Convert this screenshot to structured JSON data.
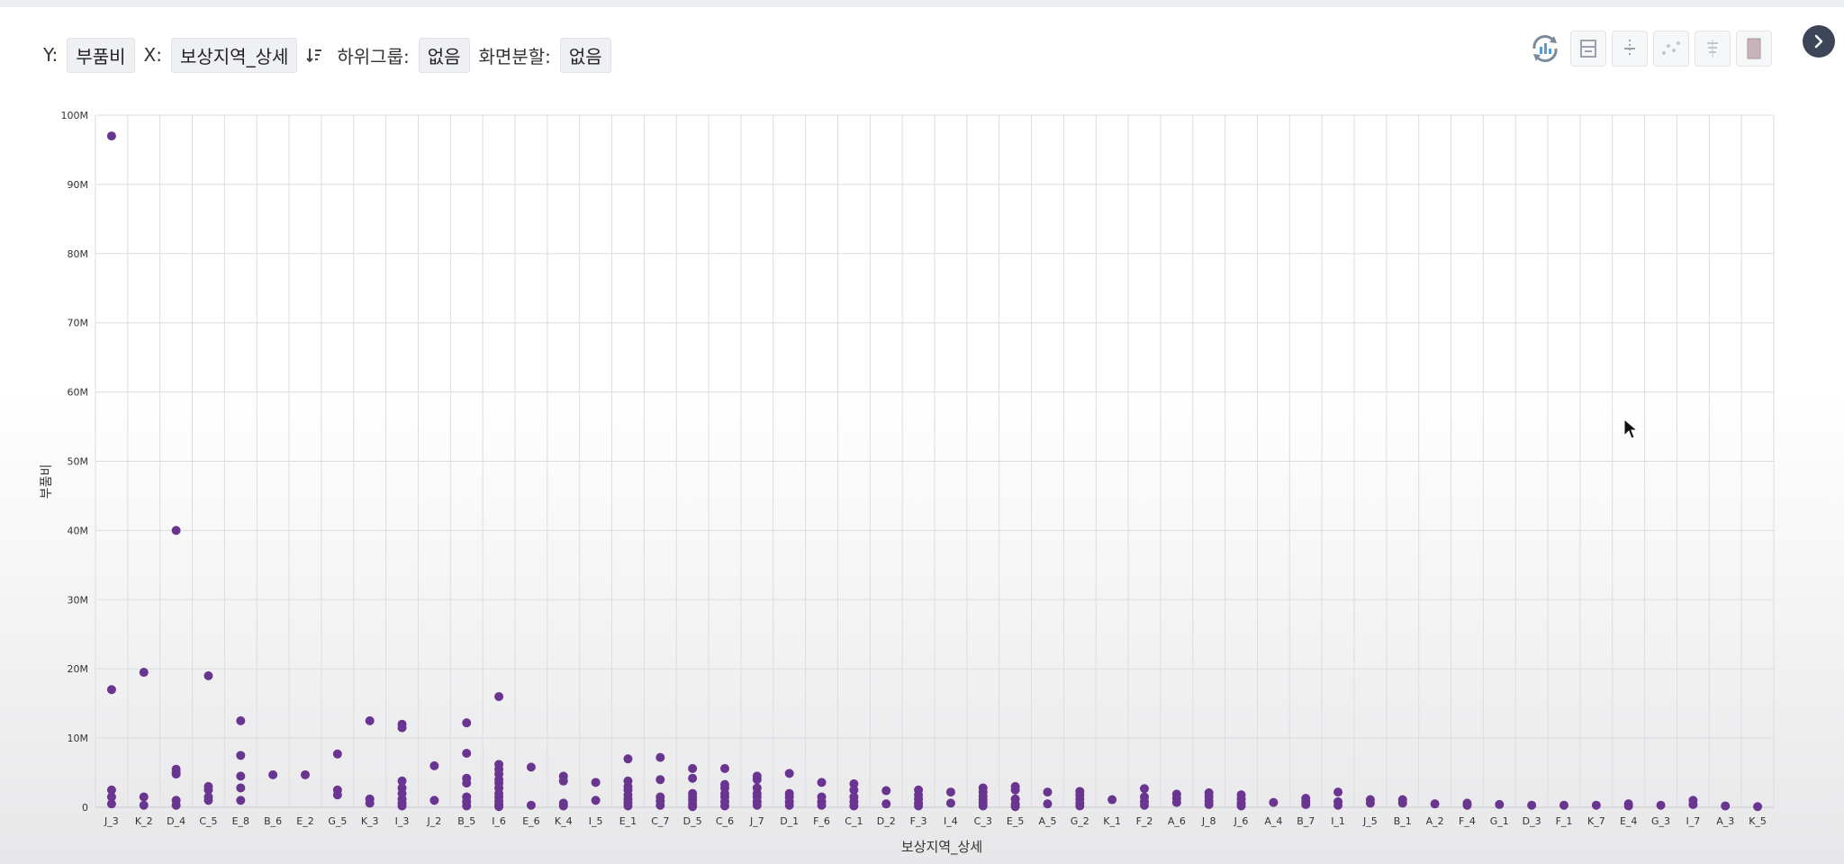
{
  "toolbar": {
    "y_label": "Y:",
    "y_value": "부품비",
    "x_label": "X:",
    "x_value": "보상지역_상세",
    "subgroup_label": "하위그룹:",
    "subgroup_value": "없음",
    "split_label": "화면분할:",
    "split_value": "없음",
    "icons": [
      "refresh-chart-icon",
      "layout-icon",
      "dotted-line-icon",
      "scatter-icon",
      "stack-icon",
      "panel-icon",
      "next-arrow-icon"
    ]
  },
  "chart_data": {
    "type": "scatter",
    "title": "",
    "xlabel": "보상지역_상세",
    "ylabel": "부품비",
    "ylim": [
      0,
      100000000
    ],
    "yticks": [
      "0",
      "10M",
      "20M",
      "30M",
      "40M",
      "50M",
      "60M",
      "70M",
      "80M",
      "90M",
      "100M"
    ],
    "grid": true,
    "marker_color": "#6a3591",
    "categories": [
      "J_3",
      "K_2",
      "D_4",
      "C_5",
      "E_8",
      "B_6",
      "E_2",
      "G_5",
      "K_3",
      "I_3",
      "J_2",
      "B_5",
      "I_6",
      "E_6",
      "K_4",
      "I_5",
      "E_1",
      "C_7",
      "D_5",
      "C_6",
      "J_7",
      "D_1",
      "F_6",
      "C_1",
      "D_2",
      "F_3",
      "I_4",
      "C_3",
      "E_5",
      "A_5",
      "G_2",
      "K_1",
      "F_2",
      "A_6",
      "J_8",
      "J_6",
      "A_4",
      "B_7",
      "I_1",
      "J_5",
      "B_1",
      "A_2",
      "F_4",
      "G_1",
      "D_3",
      "F_1",
      "K_7",
      "E_4",
      "G_3",
      "I_7",
      "A_3",
      "K_5"
    ],
    "points": [
      {
        "x": "J_3",
        "y": [
          97000000,
          17000000,
          2500000,
          1500000,
          500000
        ]
      },
      {
        "x": "K_2",
        "y": [
          19500000,
          1500000,
          300000
        ]
      },
      {
        "x": "D_4",
        "y": [
          40000000,
          5500000,
          5000000,
          4800000,
          1000000,
          300000
        ]
      },
      {
        "x": "C_5",
        "y": [
          19000000,
          3000000,
          2500000,
          1500000,
          1000000
        ]
      },
      {
        "x": "E_8",
        "y": [
          12500000,
          7500000,
          4500000,
          2800000,
          1000000
        ]
      },
      {
        "x": "B_6",
        "y": [
          4700000
        ]
      },
      {
        "x": "E_2",
        "y": [
          4700000
        ]
      },
      {
        "x": "G_5",
        "y": [
          7700000,
          2500000,
          1800000
        ]
      },
      {
        "x": "K_3",
        "y": [
          12500000,
          1200000,
          600000
        ]
      },
      {
        "x": "I_3",
        "y": [
          12000000,
          11500000,
          3800000,
          2800000,
          2000000,
          1200000,
          600000,
          200000
        ]
      },
      {
        "x": "J_2",
        "y": [
          6000000,
          1000000
        ]
      },
      {
        "x": "B_5",
        "y": [
          12200000,
          7800000,
          4200000,
          3500000,
          1500000,
          800000,
          200000
        ]
      },
      {
        "x": "I_6",
        "y": [
          16000000,
          6200000,
          5500000,
          4800000,
          4000000,
          3500000,
          2800000,
          2000000,
          1500000,
          900000,
          400000,
          100000
        ]
      },
      {
        "x": "E_6",
        "y": [
          5800000,
          300000
        ]
      },
      {
        "x": "K_4",
        "y": [
          4500000,
          3800000,
          600000,
          200000
        ]
      },
      {
        "x": "I_5",
        "y": [
          3600000,
          1000000
        ]
      },
      {
        "x": "E_1",
        "y": [
          7000000,
          3800000,
          3000000,
          2500000,
          1800000,
          1200000,
          700000,
          200000
        ]
      },
      {
        "x": "C_7",
        "y": [
          7200000,
          4000000,
          1500000,
          900000,
          300000
        ]
      },
      {
        "x": "D_5",
        "y": [
          5600000,
          4200000,
          2000000,
          1500000,
          1000000,
          500000,
          100000
        ]
      },
      {
        "x": "C_6",
        "y": [
          5600000,
          3300000,
          2800000,
          2000000,
          1500000,
          800000,
          200000
        ]
      },
      {
        "x": "J_7",
        "y": [
          4500000,
          4000000,
          2800000,
          2000000,
          1500000,
          800000,
          300000
        ]
      },
      {
        "x": "D_1",
        "y": [
          4900000,
          2000000,
          1500000,
          800000,
          300000
        ]
      },
      {
        "x": "F_6",
        "y": [
          3600000,
          1500000,
          800000,
          300000
        ]
      },
      {
        "x": "C_1",
        "y": [
          3400000,
          2500000,
          1500000,
          800000,
          200000
        ]
      },
      {
        "x": "D_2",
        "y": [
          2400000,
          500000
        ]
      },
      {
        "x": "F_3",
        "y": [
          2500000,
          1800000,
          1200000,
          600000,
          200000
        ]
      },
      {
        "x": "I_4",
        "y": [
          2200000,
          600000
        ]
      },
      {
        "x": "C_3",
        "y": [
          2800000,
          2200000,
          1600000,
          1100000,
          600000,
          200000
        ]
      },
      {
        "x": "E_5",
        "y": [
          3000000,
          2500000,
          1200000,
          500000,
          100000
        ]
      },
      {
        "x": "A_5",
        "y": [
          2200000,
          500000
        ]
      },
      {
        "x": "G_2",
        "y": [
          2300000,
          1800000,
          1200000,
          600000,
          200000
        ]
      },
      {
        "x": "K_1",
        "y": [
          1100000
        ]
      },
      {
        "x": "F_2",
        "y": [
          2700000,
          1500000,
          800000,
          300000
        ]
      },
      {
        "x": "A_6",
        "y": [
          1900000,
          1300000,
          700000
        ]
      },
      {
        "x": "J_8",
        "y": [
          2100000,
          1500000,
          900000,
          400000
        ]
      },
      {
        "x": "J_6",
        "y": [
          1800000,
          1200000,
          600000,
          200000
        ]
      },
      {
        "x": "A_4",
        "y": [
          700000
        ]
      },
      {
        "x": "B_7",
        "y": [
          1300000,
          800000,
          400000
        ]
      },
      {
        "x": "I_1",
        "y": [
          2200000,
          800000,
          300000
        ]
      },
      {
        "x": "J_5",
        "y": [
          1100000,
          600000
        ]
      },
      {
        "x": "B_1",
        "y": [
          1100000,
          600000
        ]
      },
      {
        "x": "A_2",
        "y": [
          500000
        ]
      },
      {
        "x": "F_4",
        "y": [
          600000,
          300000
        ]
      },
      {
        "x": "G_1",
        "y": [
          400000
        ]
      },
      {
        "x": "D_3",
        "y": [
          300000
        ]
      },
      {
        "x": "F_1",
        "y": [
          300000
        ]
      },
      {
        "x": "K_7",
        "y": [
          300000
        ]
      },
      {
        "x": "E_4",
        "y": [
          500000,
          200000
        ]
      },
      {
        "x": "G_3",
        "y": [
          300000
        ]
      },
      {
        "x": "I_7",
        "y": [
          1000000,
          400000
        ]
      },
      {
        "x": "A_3",
        "y": [
          200000
        ]
      },
      {
        "x": "K_5",
        "y": [
          100000
        ]
      }
    ]
  }
}
